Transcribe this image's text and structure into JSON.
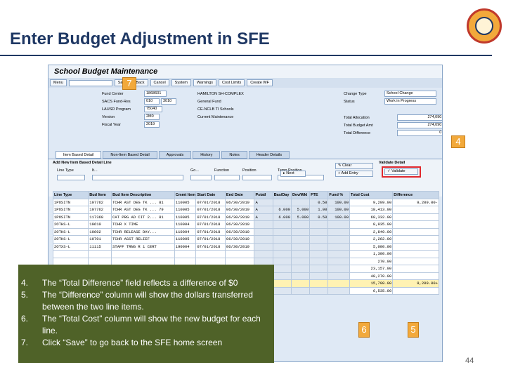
{
  "slide": {
    "title": "Enter Budget Adjustment in SFE",
    "page_number": "44",
    "notes": [
      {
        "num": "4.",
        "text": "The “Total Difference” field reflects a difference of $0"
      },
      {
        "num": "5.",
        "text": "The “Difference” column will show the dollars transferred between the two line items."
      },
      {
        "num": "6.",
        "text": "The “Total Cost” column will show the new budget for each line."
      },
      {
        "num": "7.",
        "text": "Click “Save” to go back to the SFE home screen"
      }
    ],
    "annotations": {
      "a7": "7",
      "a4": "4",
      "a6": "6",
      "a5": "5"
    },
    "colors": {
      "title": "#1f3864",
      "note_bg": "#4f6228",
      "callout": "#f2a93b",
      "highlight": "#e0282e"
    }
  },
  "sap": {
    "title": "School Budget Maintenance",
    "toolbar": {
      "menu": "Menu",
      "save": "Save",
      "back": "Back",
      "cancel": "Cancel",
      "system": "System",
      "warnings": "Warnings",
      "cost_limits": "Cost Limits",
      "create_wf": "Create WF"
    },
    "fields": {
      "fund_center": {
        "label": "Fund Center",
        "value": "1868601",
        "desc": "HAMILTON SH-COMPLEX"
      },
      "sacs_fund": {
        "label": "SACS Fund-Res",
        "value": "010",
        "value2": "3010",
        "desc": "General Fund"
      },
      "lausd_program": {
        "label": "LAUSD Program",
        "value": "75040",
        "desc": "CE-NCLB TI Schools"
      },
      "version": {
        "label": "Version",
        "value": "2M0",
        "desc": "Current Maintenance"
      },
      "fiscal_year": {
        "label": "Fiscal Year",
        "value": "2019"
      },
      "change_type": {
        "label": "Change Type",
        "value": "School Change"
      },
      "status": {
        "label": "Status",
        "value": "Work in Progress"
      },
      "total_allocation": {
        "label": "Total Allocation",
        "value": "274,090.00"
      },
      "total_budget_amt": {
        "label": "Total Budget Amt",
        "value": "274,090.00"
      },
      "total_difference": {
        "label": "Total Difference",
        "value": "0.00"
      }
    },
    "tabs": [
      "Item Based Detail",
      "Non-Item Based Detail",
      "Approvals",
      "History",
      "Notes",
      "Header Details"
    ],
    "detail": {
      "title": "Add New Item Based Detail Line",
      "validate_title": "Validate Detail",
      "labels": {
        "line_type": "Line Type",
        "item": "Item",
        "go": "Go...",
        "function": "Function",
        "position": "Position",
        "temp_position": "Temp Position"
      },
      "item_value": "It...",
      "buttons": {
        "clear": "Clear",
        "next": "Next",
        "add_entry": "Add Entry",
        "validate": "Validate"
      }
    },
    "grid": {
      "columns": [
        "Line Type",
        "Bud Item",
        "Bud Item Description",
        "Cmmt Item",
        "Start Date",
        "End Date",
        "Pstatl",
        "Bas/Day",
        "Dev/Wkl",
        "FTE",
        "Fund %",
        "Total Cost",
        "Difference"
      ],
      "rows": [
        [
          "1POSITN",
          "107762",
          "TCHR AST DEG TK ... 81",
          "110005",
          "07/01/2018",
          "06/30/2019",
          "A",
          "",
          "",
          "0.50",
          "100.00",
          "9,209.00",
          "9,209.00-"
        ],
        [
          "1POSITN",
          "107762",
          "TCHR AST DEG TK ... 79",
          "110005",
          "07/01/2018",
          "06/30/2019",
          "A",
          "6.000",
          "5.000",
          "1.00",
          "100.00",
          "18,413.00",
          ""
        ],
        [
          "1POSITN",
          "117360",
          "CAT PRG AD CIT 2... 81",
          "110005",
          "07/01/2018",
          "06/30/2019",
          "A",
          "6.000",
          "5.000",
          "0.50",
          "100.00",
          "68,332.00",
          ""
        ],
        [
          "2OTHS-L",
          "10610",
          "TCHR X TIME",
          "110004",
          "07/01/2018",
          "06/30/2019",
          "",
          "",
          "",
          "",
          "",
          "8,935.00",
          ""
        ],
        [
          "2OTHS-L",
          "10602",
          "TCHR RELEASE DAY...",
          "110004",
          "07/01/2018",
          "06/30/2019",
          "",
          "",
          "",
          "",
          "",
          "2,849.00",
          ""
        ],
        [
          "2OTHS-L",
          "10701",
          "TCHR ASST RELIEF",
          "110005",
          "07/01/2018",
          "06/30/2019",
          "",
          "",
          "",
          "",
          "",
          "2,262.00",
          ""
        ],
        [
          "2OTXS-L",
          "11115",
          "STAFF TRNG R 1 CERT",
          "190004",
          "07/01/2018",
          "06/30/2019",
          "",
          "",
          "",
          "",
          "",
          "5,000.00",
          ""
        ],
        [
          "",
          "",
          "",
          "",
          "",
          "",
          "",
          "",
          "",
          "",
          "",
          "1,300.00",
          ""
        ],
        [
          "",
          "",
          "",
          "",
          "",
          "",
          "",
          "",
          "",
          "",
          "",
          "270.00",
          ""
        ],
        [
          "",
          "",
          "",
          "",
          "",
          "",
          "",
          "",
          "",
          "",
          "",
          "23,157.00",
          ""
        ],
        [
          "",
          "",
          "",
          "",
          "",
          "",
          "",
          "",
          "",
          "",
          "",
          "48,270.00",
          ""
        ],
        [
          "",
          "",
          "",
          "",
          "",
          "",
          "",
          "",
          "",
          "",
          "",
          "15,708.00",
          "9,209.00+"
        ],
        [
          "",
          "",
          "",
          "",
          "",
          "",
          "",
          "",
          "",
          "",
          "",
          "6,535.00",
          ""
        ]
      ]
    }
  }
}
